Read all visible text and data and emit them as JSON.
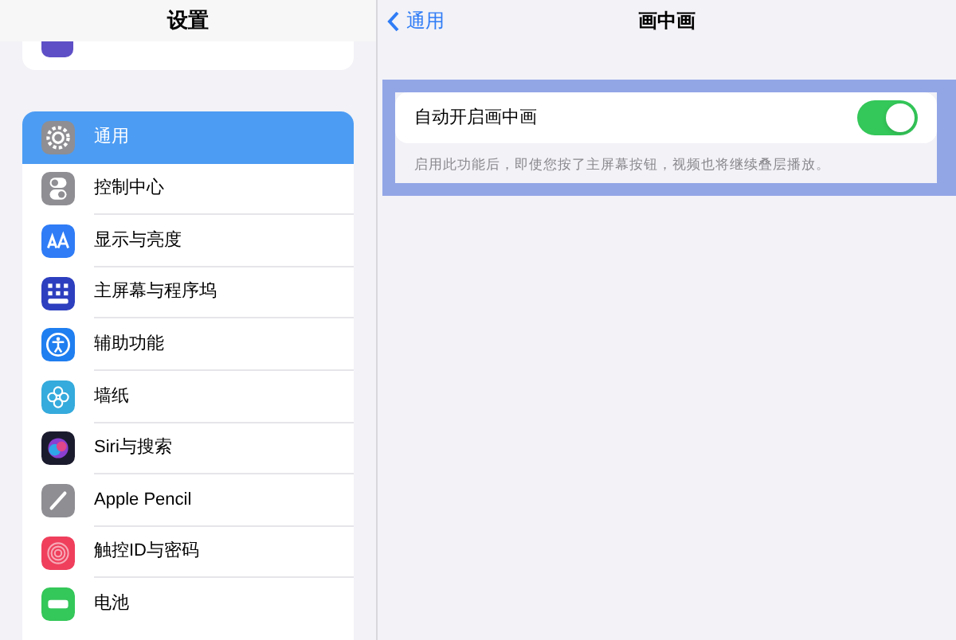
{
  "sidebar": {
    "title": "设置",
    "items": [
      {
        "label": "通用",
        "kind": "gear",
        "selected": true
      },
      {
        "label": "控制中心",
        "kind": "switches",
        "selected": false
      },
      {
        "label": "显示与亮度",
        "kind": "text-size",
        "selected": false
      },
      {
        "label": "主屏幕与程序坞",
        "kind": "grid",
        "selected": false
      },
      {
        "label": "辅助功能",
        "kind": "person",
        "selected": false
      },
      {
        "label": "墙纸",
        "kind": "flower",
        "selected": false
      },
      {
        "label": "Siri与搜索",
        "kind": "orb",
        "selected": false
      },
      {
        "label": "Apple Pencil",
        "kind": "pencil",
        "selected": false
      },
      {
        "label": "触控ID与密码",
        "kind": "fingerprint",
        "selected": false
      },
      {
        "label": "电池",
        "kind": "battery",
        "selected": false
      }
    ]
  },
  "detail": {
    "back": "通用",
    "title": "画中画",
    "setting": {
      "label": "自动开启画中画",
      "on": true
    },
    "footnote": "启用此功能后，即使您按了主屏幕按钮，视频也将继续叠层播放。"
  }
}
